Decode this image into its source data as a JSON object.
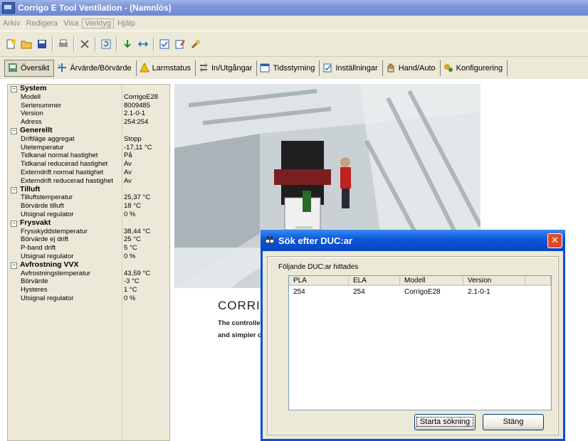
{
  "window": {
    "title": "Corrigo E Tool Ventilation - (Namnlös)"
  },
  "menu": [
    "Arkiv",
    "Redigera",
    "Visa",
    "Verktyg",
    "Hjälp"
  ],
  "toolbar_icons": [
    "new-icon",
    "open-icon",
    "save-icon",
    "print-icon",
    "delete-icon",
    "refresh-icon",
    "download-icon",
    "transfer-icon",
    "checkbox-icon",
    "edit-icon",
    "tools-icon"
  ],
  "nav": [
    {
      "label": "Översikt",
      "icon": "overview-icon"
    },
    {
      "label": "Ärvärde/Börvärde",
      "icon": "values-icon"
    },
    {
      "label": "Larmstatus",
      "icon": "alarm-icon"
    },
    {
      "label": "In/Utgångar",
      "icon": "io-icon"
    },
    {
      "label": "Tidsstyrning",
      "icon": "calendar-icon"
    },
    {
      "label": "Inställningar",
      "icon": "settings-icon"
    },
    {
      "label": "Hand/Auto",
      "icon": "hand-icon"
    },
    {
      "label": "Konfigurering",
      "icon": "config-icon"
    }
  ],
  "panel": [
    {
      "type": "group",
      "label": "System"
    },
    {
      "type": "row",
      "label": "Modell",
      "value": "CorrigoE28"
    },
    {
      "type": "row",
      "label": "Serienummer",
      "value": "8009485"
    },
    {
      "type": "row",
      "label": "Version",
      "value": "2.1-0-1"
    },
    {
      "type": "row",
      "label": "Adress",
      "value": "254:254"
    },
    {
      "type": "group",
      "label": "Generellt"
    },
    {
      "type": "row",
      "label": "Driftläge aggregat",
      "value": "Stopp"
    },
    {
      "type": "row",
      "label": "Utetemperatur",
      "value": "-17,11 °C"
    },
    {
      "type": "row",
      "label": "Tidkanal normal hastighet",
      "value": "På"
    },
    {
      "type": "row",
      "label": "Tidkanal reducerad hastighet",
      "value": "Av"
    },
    {
      "type": "row",
      "label": "Externdrift normal hastighet",
      "value": "Av"
    },
    {
      "type": "row",
      "label": "Externdrift reducerad hastighet",
      "value": "Av"
    },
    {
      "type": "group",
      "label": "Tilluft"
    },
    {
      "type": "row",
      "label": "Tilluftstemperatur",
      "value": "25,37 °C"
    },
    {
      "type": "row",
      "label": "Börvärde tilluft",
      "value": "18 °C"
    },
    {
      "type": "row",
      "label": "Utsignal regulator",
      "value": "0 %"
    },
    {
      "type": "group",
      "label": "Frysvakt"
    },
    {
      "type": "row",
      "label": "Frysskyddstemperatur",
      "value": "38,44 °C"
    },
    {
      "type": "row",
      "label": "Börvärde ej drift",
      "value": "25 °C"
    },
    {
      "type": "row",
      "label": "P-band drift",
      "value": "5 °C"
    },
    {
      "type": "row",
      "label": "Utsignal regulator",
      "value": "0 %"
    },
    {
      "type": "group",
      "label": "Avfrostning VVX"
    },
    {
      "type": "row",
      "label": "Avfrostningstemperatur",
      "value": "43,59 °C"
    },
    {
      "type": "row",
      "label": "Börvärde",
      "value": "-3 °C"
    },
    {
      "type": "row",
      "label": "Hysteres",
      "value": "1 °C"
    },
    {
      "type": "row",
      "label": "Utsignal regulator",
      "value": "0 %"
    }
  ],
  "splash": {
    "title": "CORRIG",
    "line1": "The controller",
    "line2": "and simpler op"
  },
  "dialog": {
    "title": "Sök efter DUC:ar",
    "found_label": "Följande DUC:ar hittades",
    "columns": [
      "PLA",
      "ELA",
      "Modell",
      "Version"
    ],
    "rows": [
      {
        "pla": "254",
        "ela": "254",
        "modell": "CorrigoE28",
        "version": "2.1-0-1"
      }
    ],
    "search_button": "Starta sökning",
    "close_button": "Stäng"
  }
}
